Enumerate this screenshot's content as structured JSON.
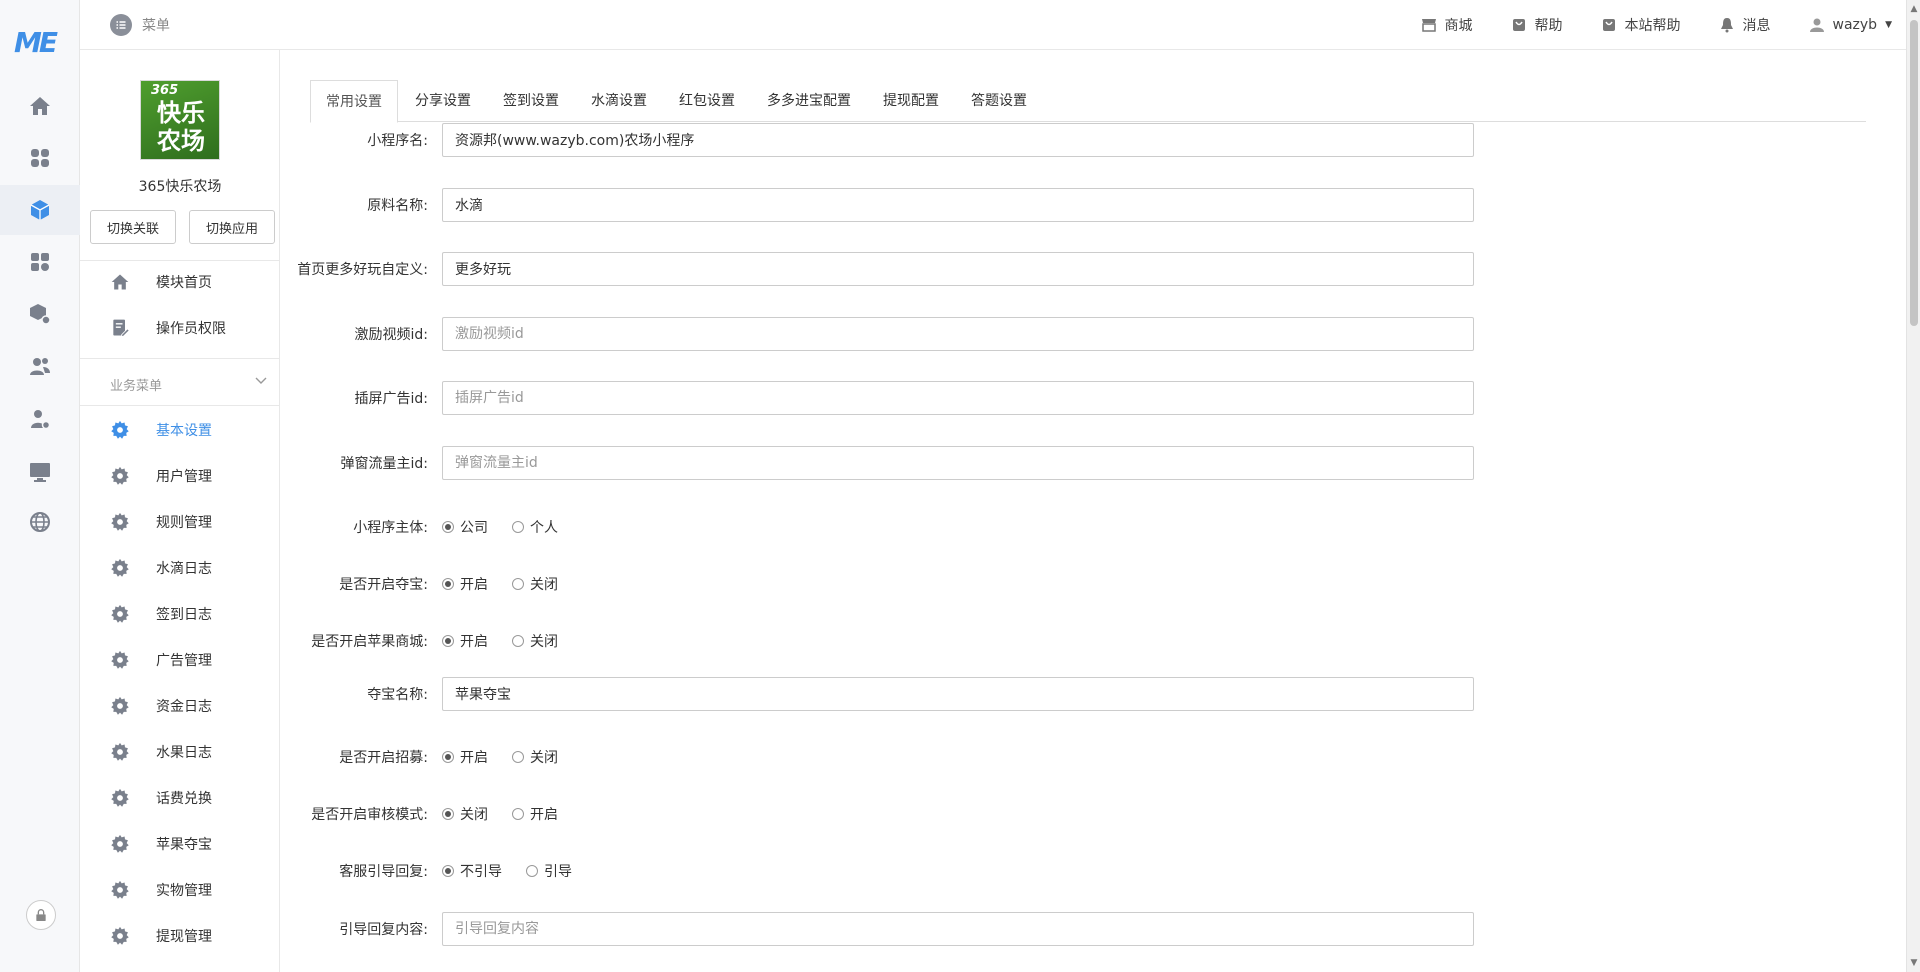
{
  "brand": {
    "logo_text": "ME"
  },
  "topbar": {
    "menu_label": "菜单",
    "links": [
      {
        "label": "商城",
        "icon": "store-icon"
      },
      {
        "label": "帮助",
        "icon": "help-bag-icon"
      },
      {
        "label": "本站帮助",
        "icon": "site-help-icon"
      },
      {
        "label": "消息",
        "icon": "bell-icon"
      },
      {
        "label": "wazyb",
        "icon": "user-icon"
      }
    ]
  },
  "rail": {
    "icons": [
      "home-icon",
      "apps-grid-icon",
      "cube-icon",
      "modules-icon",
      "box-settings-icon",
      "users-icon",
      "user-settings-icon",
      "monitor-icon",
      "globe-icon"
    ],
    "active": "cube-icon",
    "lock_icon": "lock-icon"
  },
  "app": {
    "thumb_top": "365",
    "thumb_main": "快乐农场",
    "name": "365快乐农场",
    "switch_link_label": "切换关联",
    "switch_app_label": "切换应用"
  },
  "nav_top": [
    {
      "label": "模块首页",
      "icon": "home-icon"
    },
    {
      "label": "操作员权限",
      "icon": "doc-edit-icon"
    }
  ],
  "business_menu": {
    "title": "业务菜单",
    "items": [
      {
        "label": "基本设置",
        "active": true
      },
      {
        "label": "用户管理"
      },
      {
        "label": "规则管理"
      },
      {
        "label": "水滴日志"
      },
      {
        "label": "签到日志"
      },
      {
        "label": "广告管理"
      },
      {
        "label": "资金日志"
      },
      {
        "label": "水果日志"
      },
      {
        "label": "话费兑换"
      },
      {
        "label": "苹果夺宝"
      },
      {
        "label": "实物管理"
      },
      {
        "label": "提现管理"
      }
    ]
  },
  "tabs": [
    "常用设置",
    "分享设置",
    "签到设置",
    "水滴设置",
    "红包设置",
    "多多进宝配置",
    "提现配置",
    "答题设置"
  ],
  "active_tab": "常用设置",
  "form": {
    "miniapp_name": {
      "label": "小程序名:",
      "value": "资源邦(www.wazyb.com)农场小程序",
      "placeholder": ""
    },
    "material_name": {
      "label": "原料名称:",
      "value": "水滴",
      "placeholder": ""
    },
    "home_more": {
      "label": "首页更多好玩自定义:",
      "value": "更多好玩",
      "placeholder": ""
    },
    "reward_video": {
      "label": "激励视频id:",
      "value": "",
      "placeholder": "激励视频id"
    },
    "interstitial": {
      "label": "插屏广告id:",
      "value": "",
      "placeholder": "插屏广告id"
    },
    "popup_traffic": {
      "label": "弹窗流量主id:",
      "value": "",
      "placeholder": "弹窗流量主id"
    },
    "entity": {
      "label": "小程序主体:",
      "options": [
        "公司",
        "个人"
      ],
      "selected": 0
    },
    "treasure_on": {
      "label": "是否开启夺宝:",
      "options": [
        "开启",
        "关闭"
      ],
      "selected": 0
    },
    "apple_mall_on": {
      "label": "是否开启苹果商城:",
      "options": [
        "开启",
        "关闭"
      ],
      "selected": 0
    },
    "treasure_name": {
      "label": "夺宝名称:",
      "value": "苹果夺宝",
      "placeholder": ""
    },
    "recruit_on": {
      "label": "是否开启招募:",
      "options": [
        "开启",
        "关闭"
      ],
      "selected": 0
    },
    "audit_mode": {
      "label": "是否开启审核模式:",
      "options": [
        "关闭",
        "开启"
      ],
      "selected": 0
    },
    "cs_reply": {
      "label": "客服引导回复:",
      "options": [
        "不引导",
        "引导"
      ],
      "selected": 0
    },
    "reply_content": {
      "label": "引导回复内容:",
      "value": "",
      "placeholder": "引导回复内容"
    }
  }
}
